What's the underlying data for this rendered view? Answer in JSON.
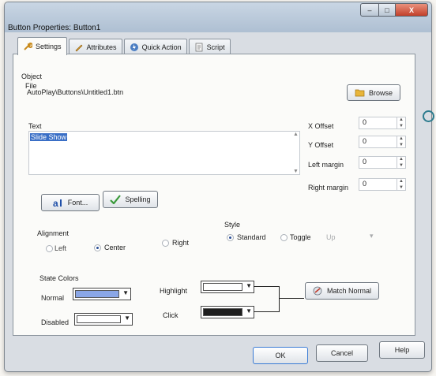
{
  "window": {
    "title": "Button Properties: Button1"
  },
  "title_buttons": {
    "minimize_label": "–",
    "maximize_label": "□",
    "close_label": "X"
  },
  "tabs": [
    {
      "label": "Settings",
      "icon": "wrench-icon",
      "active": true
    },
    {
      "label": "Attributes",
      "icon": "pencil-icon",
      "active": false
    },
    {
      "label": "Quick Action",
      "icon": "lightning-icon",
      "active": false
    },
    {
      "label": "Script",
      "icon": "script-icon",
      "active": false
    }
  ],
  "object": {
    "section_label": "Object",
    "file_label": "File",
    "file_value": "AutoPlay\\Buttons\\Untitled1.btn",
    "browse_label": "Browse",
    "text_label": "Text",
    "text_value": "Slide Show"
  },
  "offsets": [
    {
      "label": "X Offset",
      "value": "0"
    },
    {
      "label": "Y Offset",
      "value": "0"
    },
    {
      "label": "Left margin",
      "value": "0"
    },
    {
      "label": "Right margin",
      "value": "0"
    }
  ],
  "font_button": "Font...",
  "spelling_button": "Spelling",
  "alignment": {
    "label": "Alignment",
    "options": [
      "Left",
      "Center",
      "Right"
    ],
    "selected": "Center"
  },
  "style": {
    "label": "Style",
    "options": [
      "Standard",
      "Toggle"
    ],
    "selected": "Standard",
    "toggle_state_value": "Up"
  },
  "state_colors": {
    "label": "State Colors",
    "normal_label": "Normal",
    "normal_color": "#8aa6e6",
    "disabled_label": "Disabled",
    "disabled_color": "#ffffff",
    "highlight_label": "Highlight",
    "highlight_color": "#ffffff",
    "click_label": "Click",
    "click_color": "#1e1e1e",
    "match_normal_label": "Match Normal"
  },
  "footer": {
    "ok_label": "OK",
    "cancel_label": "Cancel",
    "help_label": "Help"
  }
}
